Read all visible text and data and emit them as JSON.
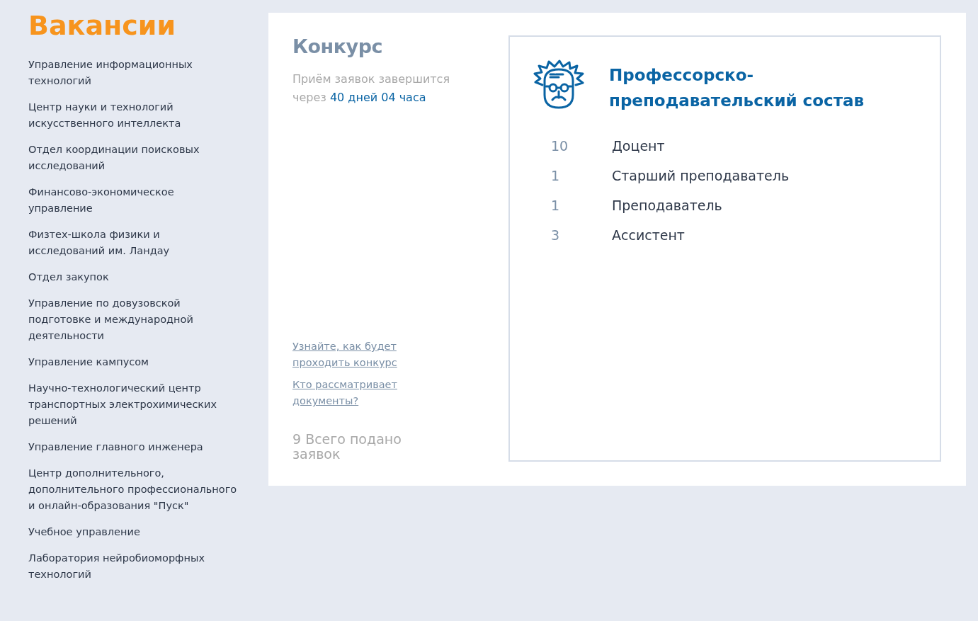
{
  "sidebar": {
    "title": "Вакансии",
    "items": [
      "Управление информационных технологий",
      "Центр науки и технологий искусственного интеллекта",
      "Отдел координации поисковых исследований",
      "Финансово-экономическое управление",
      "Физтех-школа физики и исследований им. Ландау",
      "Отдел закупок",
      "Управление по довузовской подготовке и международной деятельности",
      "Управление кампусом",
      "Научно-технологический центр транспортных электрохимических решений",
      "Управление главного инженера",
      "Центр дополнительного, дополнительного профессионального и онлайн-образования \"Пуск\"",
      "Учебное управление",
      "Лаборатория нейробиоморфных технологий"
    ]
  },
  "contest": {
    "title": "Конкурс",
    "deadline_text": "Приём заявок завершится через",
    "deadline_value": "40 дней 04 часа",
    "links": [
      "Узнайте, как будет проходить конкурс",
      "Кто рассматривает документы?"
    ],
    "total": "9 Всего подано заявок"
  },
  "category": {
    "title": "Профессорско-преподавательский состав",
    "positions": [
      {
        "count": "10",
        "name": "Доцент"
      },
      {
        "count": "1",
        "name": "Старший преподаватель"
      },
      {
        "count": "1",
        "name": "Преподаватель"
      },
      {
        "count": "3",
        "name": "Ассистент"
      }
    ]
  }
}
